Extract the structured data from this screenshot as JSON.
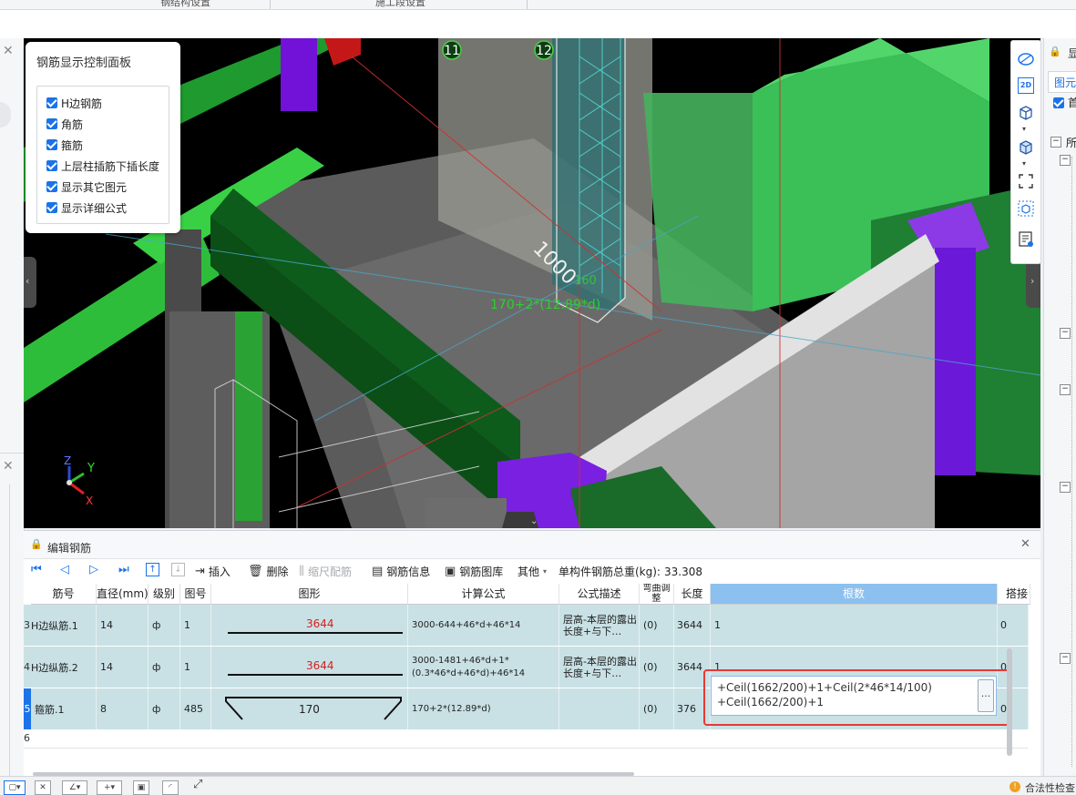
{
  "top_tabs": [
    "钢结构设置",
    "施工段设置"
  ],
  "rebar_panel": {
    "title": "钢筋显示控制面板",
    "options": [
      {
        "label": "H边钢筋",
        "checked": true
      },
      {
        "label": "角筋",
        "checked": true
      },
      {
        "label": "箍筋",
        "checked": true
      },
      {
        "label": "上层柱插筋下插长度",
        "checked": true
      },
      {
        "label": "显示其它图元",
        "checked": true
      },
      {
        "label": "显示详细公式",
        "checked": true
      }
    ]
  },
  "viewport": {
    "axis_labels": [
      "11",
      "12"
    ],
    "dim_text": "1000",
    "dim_text_short": "160",
    "formula_overlay": "170+2*(12.89*d)",
    "gizmo": {
      "z": "Z",
      "y": "Y",
      "x": "X"
    }
  },
  "view_toolbar": {
    "label_2d": "2D"
  },
  "right_panel": {
    "tab": "图元",
    "check_label": "首",
    "tree_root": "所"
  },
  "edit_panel": {
    "title": "编辑钢筋",
    "toolbar": {
      "insert": "插入",
      "delete": "删除",
      "scale": "缩尺配筋",
      "info": "钢筋信息",
      "library": "钢筋图库",
      "other": "其他",
      "total_weight_label": "单构件钢筋总重(kg):",
      "total_weight": "33.308"
    },
    "columns": [
      "筋号",
      "直径(mm)",
      "级别",
      "图号",
      "图形",
      "计算公式",
      "公式描述",
      "弯曲调整",
      "长度",
      "根数",
      "搭接"
    ],
    "rows": [
      {
        "num": "3",
        "name": "H边纵筋.1",
        "dia": "14",
        "grade": "ф",
        "fig": "1",
        "shape_val": "3644",
        "formula": "3000-644+46*d+46*14",
        "desc": "层高-本层的露出长度+与下…",
        "bend": "(0)",
        "length": "3644",
        "count": "1",
        "lap": "0"
      },
      {
        "num": "4",
        "name": "H边纵筋.2",
        "dia": "14",
        "grade": "ф",
        "fig": "1",
        "shape_val": "3644",
        "formula": "3000-1481+46*d+1*(0.3*46*d+46*d)+46*14",
        "desc": "层高-本层的露出长度+与下…",
        "bend": "(0)",
        "length": "3644",
        "count": "1",
        "lap": "0"
      },
      {
        "num": "5",
        "name": "箍筋.1",
        "dia": "8",
        "grade": "ф",
        "fig": "485",
        "shape_val": "170",
        "formula": "170+2*(12.89*d)",
        "desc": "",
        "bend": "(0)",
        "length": "376",
        "count_line1": "+Ceil(1662/200)+1+Ceil(2*46*14/100)",
        "count_line2": "+Ceil(1662/200)+1",
        "lap": "0"
      },
      {
        "num": "6"
      }
    ],
    "ellipsis": "..."
  },
  "status_bar": {
    "legal_check": "合法性检查"
  }
}
